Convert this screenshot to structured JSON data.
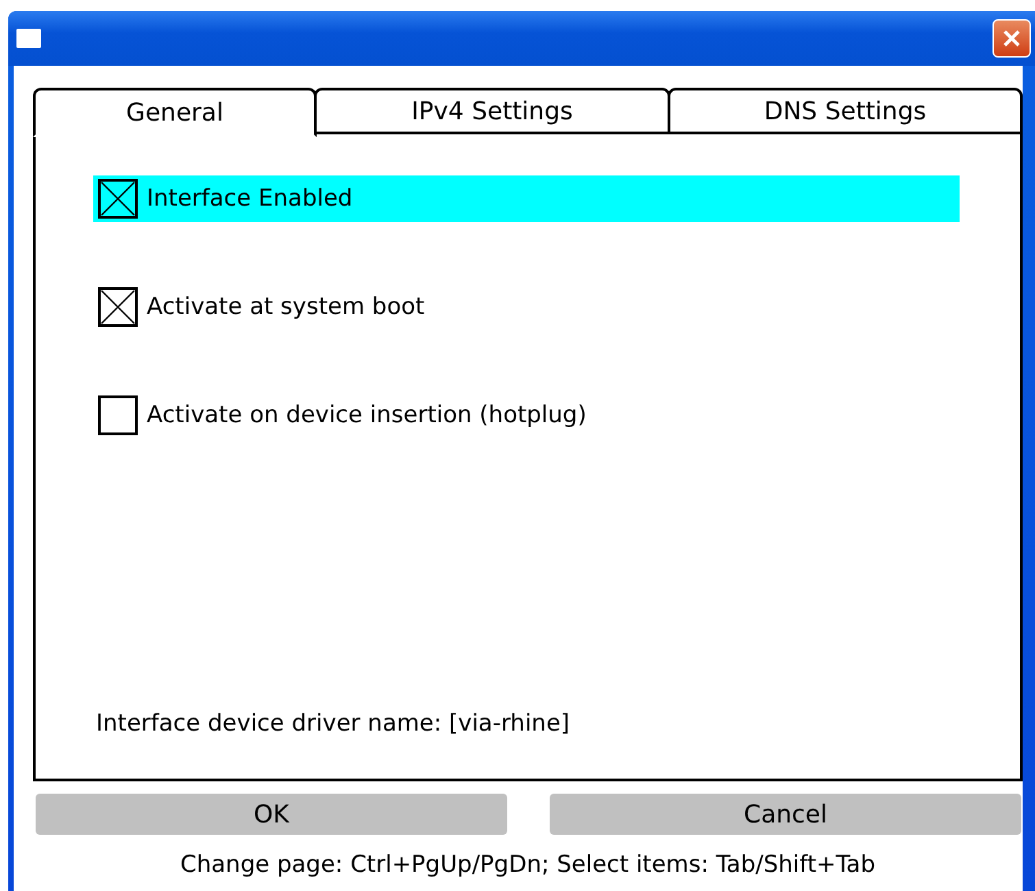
{
  "tabs": [
    {
      "label": "General",
      "selected": true
    },
    {
      "label": "IPv4 Settings",
      "selected": false
    },
    {
      "label": "DNS Settings",
      "selected": false
    }
  ],
  "options": [
    {
      "label": "Interface Enabled",
      "checked": true,
      "focused": true
    },
    {
      "label": "Activate at system boot",
      "checked": true,
      "focused": false
    },
    {
      "label": "Activate on device insertion (hotplug)",
      "checked": false,
      "focused": false
    }
  ],
  "driver_info": "Interface device driver name: [via-rhine]",
  "buttons": [
    "OK",
    "Cancel"
  ],
  "status_bar": "Change page: Ctrl+PgUp/PgDn; Select items: Tab/Shift+Tab"
}
